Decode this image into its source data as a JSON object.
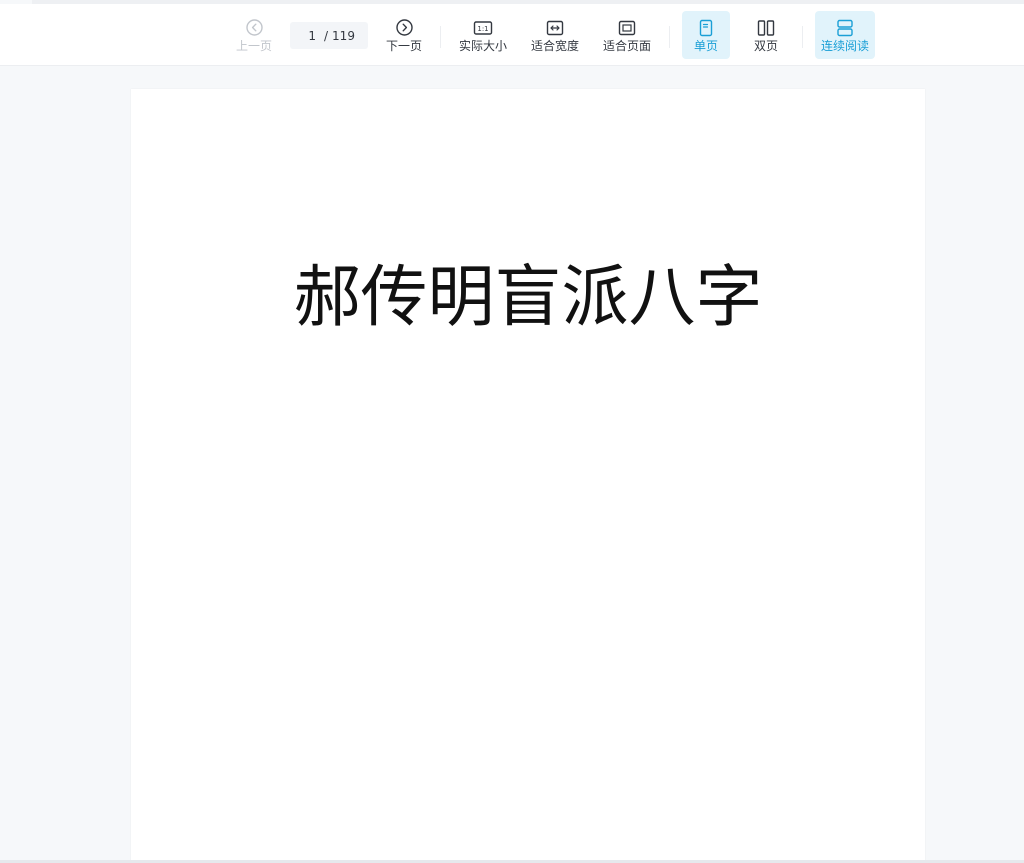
{
  "toolbar": {
    "prev_label": "上一页",
    "page_current": "1",
    "page_separator": "/",
    "page_total": "119",
    "next_label": "下一页",
    "actual_size_label": "实际大小",
    "actual_size_icon_text": "1:1",
    "fit_width_label": "适合宽度",
    "fit_page_label": "适合页面",
    "single_page_label": "单页",
    "double_page_label": "双页",
    "continuous_label": "连续阅读"
  },
  "colors": {
    "accent": "#1a9fd6",
    "accent_bg": "#e1f3fb",
    "disabled": "#c2c6cc"
  },
  "icons": {
    "prev": "chevron-left-circle-icon",
    "next": "chevron-right-circle-icon",
    "actual_size": "actual-size-icon",
    "fit_width": "fit-width-icon",
    "fit_page": "fit-page-icon",
    "single_page": "single-page-icon",
    "double_page": "double-page-icon",
    "continuous": "continuous-scroll-icon"
  },
  "document": {
    "title": "郝传明盲派八字"
  }
}
